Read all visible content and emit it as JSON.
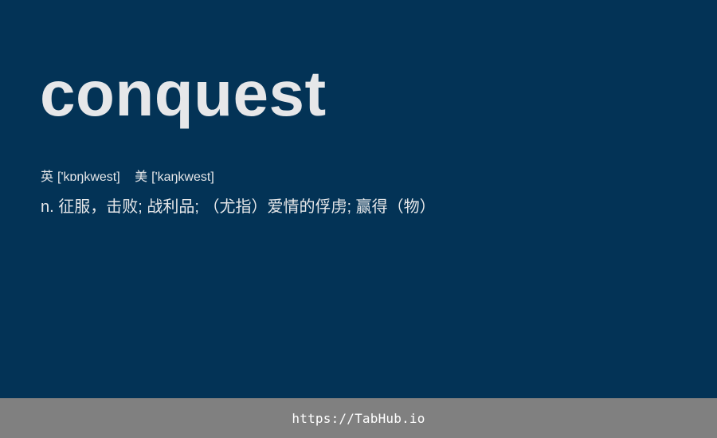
{
  "word": "conquest",
  "phonetics": {
    "uk_label": "英",
    "uk": "['kɒŋkwest]",
    "us_label": "美",
    "us": "['kaŋkwest]"
  },
  "definition": "n. 征服，击败; 战利品; （尤指）爱情的俘虏; 赢得（物）",
  "footer": {
    "link_text": "https://TabHub.io"
  },
  "colors": {
    "background": "#033356",
    "text": "#e6e7e9",
    "footer_background": "#808080",
    "footer_text": "#ffffff"
  }
}
